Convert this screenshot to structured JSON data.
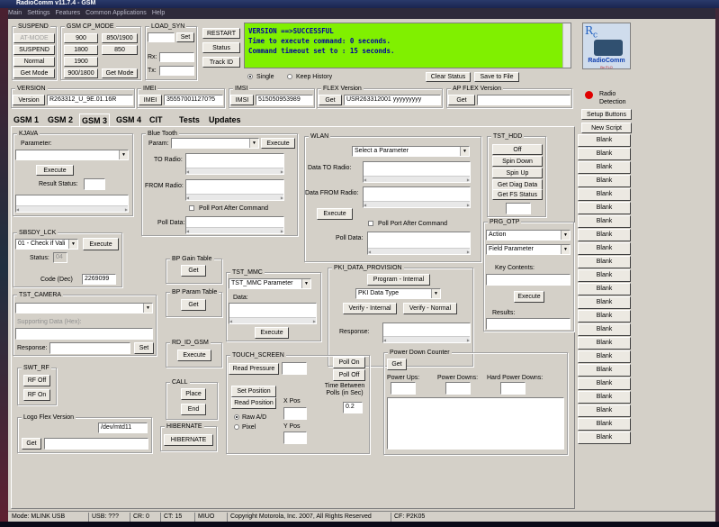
{
  "window": {
    "title": "RadioComm v11.7.4 - GSM"
  },
  "menu": [
    "Main",
    "Settings",
    "Features",
    "Common Applications",
    "Help"
  ],
  "suspend": {
    "caption": "SUSPEND",
    "atmode": "AT-MODE",
    "suspend": "SUSPEND",
    "normal": "Normal",
    "getmode": "Get Mode"
  },
  "gsm_cp_mode": {
    "caption": "GSM CP_MODE",
    "b900": "900",
    "b850_1900": "850/1900",
    "b1800": "1800",
    "b850": "850",
    "b1900": "1900",
    "b900_1800": "900/1800",
    "getmode": "Get Mode"
  },
  "load_syn": {
    "caption": "LOAD_SYN",
    "set": "Set",
    "rx": "Rx:",
    "tx": "Tx:"
  },
  "side_buttons": {
    "restart": "RESTART",
    "status": "Status",
    "track_id": "Track ID"
  },
  "console": {
    "lines": [
      "VERSION ==>SUCCESSFUL",
      "Time to execute command: 0 seconds.",
      "Command timeout set to : 15 seconds."
    ],
    "color": "#80f000",
    "text_color": "#0000a0"
  },
  "history": {
    "single": "Single",
    "keep": "Keep History",
    "clear": "Clear Status",
    "save": "Save to File"
  },
  "logo": {
    "text": "RadioComm",
    "by": "By FLO",
    "detection": "Radio Detection",
    "led_color": "#e00000"
  },
  "version": {
    "caption": "VERSION",
    "button": "Version",
    "value": "R263312_U_9E.01.16R"
  },
  "imei": {
    "caption": "IMEI",
    "button": "IMEI",
    "value": "355570011270?5"
  },
  "imsi": {
    "caption": "IMSI",
    "button": "IMSI",
    "value": "515050953989"
  },
  "flex": {
    "caption": "FLEX Version",
    "button": "Get",
    "value": "USR263312001 yyyyyyyyy"
  },
  "apflex": {
    "caption": "AP FLEX Version",
    "button": "Get",
    "value": ""
  },
  "tabs": [
    "GSM 1",
    "GSM 2",
    "GSM 3",
    "GSM 4",
    "CIT",
    "Tests",
    "Updates"
  ],
  "setup_buttons": "Setup Buttons",
  "new_script": "New Script",
  "blank_buttons": [
    "Blank",
    "Blank",
    "Blank",
    "Blank",
    "Blank",
    "Blank",
    "Blank",
    "Blank",
    "Blank",
    "Blank",
    "Blank",
    "Blank",
    "Blank",
    "Blank",
    "Blank",
    "Blank",
    "Blank",
    "Blank",
    "Blank",
    "Blank",
    "Blank",
    "Blank",
    "Blank"
  ],
  "kjava": {
    "caption": "KJAVA",
    "parameter": "Parameter:",
    "execute": "Execute",
    "result": "Result Status:"
  },
  "bluetooth": {
    "caption": "Blue Tooth",
    "param": "Param:",
    "execute": "Execute",
    "to_radio": "TO Radio:",
    "from_radio": "FROM Radio:",
    "poll_port": "Poll Port After Command",
    "poll_data": "Poll Data:"
  },
  "wlan": {
    "caption": "WLAN",
    "select": "Select a Parameter",
    "data_to": "Data TO Radio:",
    "data_from": "Data FROM Radio:",
    "execute": "Execute",
    "poll_port": "Poll Port After Command",
    "poll_data": "Poll Data:"
  },
  "tst_hdd": {
    "caption": "TST_HDD",
    "off": "Off",
    "spin_down": "Spin Down",
    "spin_up": "Spin Up",
    "diag": "Get Diag Data",
    "fs": "Get FS Status"
  },
  "prg_otp": {
    "caption": "PRG_OTP",
    "action": "Action",
    "field": "Field Parameter",
    "key": "Key Contents:",
    "execute": "Execute",
    "results": "Results:"
  },
  "sbsdy": {
    "caption": "SBSDY_LCK",
    "select": "01 - Check if Vali",
    "execute": "Execute",
    "status": "Status:",
    "status_val": "04",
    "code": "Code (Dec)",
    "code_val": "2269099"
  },
  "bp_gain": {
    "caption": "BP Gain Table",
    "get": "Get"
  },
  "bp_param": {
    "caption": "BP Param Table",
    "get": "Get"
  },
  "tst_mmc": {
    "caption": "TST_MMC",
    "select": "TST_MMC Parameter",
    "data": "Data:",
    "execute": "Execute"
  },
  "pki": {
    "caption": "PKI_DATA_PROVISION",
    "program": "Program - Internal",
    "select": "PKI Data Type",
    "verify_int": "Verify - Internal",
    "verify_norm": "Verify - Normal",
    "response": "Response:"
  },
  "tst_camera": {
    "caption": "TST_CAMERA",
    "supporting": "Supporting Data (Hex):",
    "response": "Response:",
    "set": "Set"
  },
  "rd_id": {
    "caption": "RD_ID_GSM",
    "execute": "Execute"
  },
  "touch": {
    "caption": "TOUCH_SCREEN",
    "read_pressure": "Read Pressure",
    "poll_on": "Poll On",
    "poll_off": "Poll Off",
    "time_between": "Time Between Polls (in Sec)",
    "time_val": "0.2",
    "set_position": "Set Position",
    "read_position": "Read Position",
    "xpos": "X Pos",
    "ypos": "Y Pos",
    "raw": "Raw A/D",
    "pixel": "Pixel"
  },
  "power": {
    "caption": "Power Down Counter",
    "get": "Get",
    "ups": "Power Ups:",
    "downs": "Power Downs:",
    "hard": "Hard Power Downs:"
  },
  "swt_rf": {
    "caption": "SWT_RF",
    "off": "RF Off",
    "on": "RF On"
  },
  "call": {
    "caption": "CALL",
    "place": "Place",
    "end": "End"
  },
  "logo_flex": {
    "caption": "Logo Flex Version",
    "path": "/dev/mtd11",
    "get": "Get"
  },
  "hibernate": {
    "caption": "HIBERNATE",
    "button": "HIBERNATE"
  },
  "status": {
    "mode": "Mode: MLINK USB",
    "usb": "USB: ???",
    "cr": "CR: 0",
    "ct": "CT: 15",
    "miuo": "MIUO",
    "copy": "Copyright Motorola, Inc. 2007, All Rights Reserved",
    "cf": "CF: P2K05"
  }
}
